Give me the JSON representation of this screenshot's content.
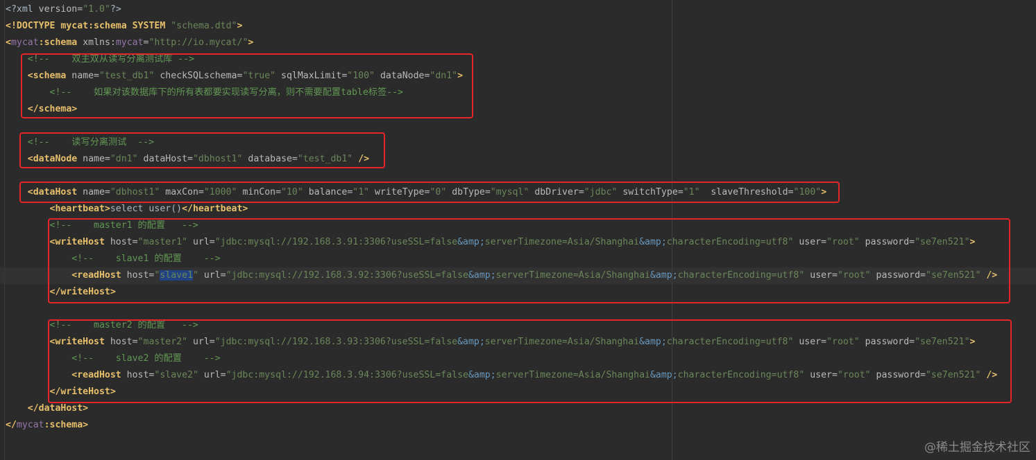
{
  "editor": {
    "lines": [
      [
        {
          "t": "<?",
          "k": "txt"
        },
        {
          "t": "xml",
          "k": "txt"
        },
        {
          "t": " version=",
          "k": "a"
        },
        {
          "t": "\"1.0\"",
          "k": "v"
        },
        {
          "t": "?>",
          "k": "txt"
        }
      ],
      [
        {
          "t": "<!",
          "k": "t"
        },
        {
          "t": "DOCTYPE mycat:schema SYSTEM ",
          "k": "t"
        },
        {
          "t": "\"schema.dtd\"",
          "k": "v"
        },
        {
          "t": ">",
          "k": "t"
        }
      ],
      [
        {
          "t": "<",
          "k": "t"
        },
        {
          "t": "mycat",
          "k": "ns"
        },
        {
          "t": ":schema ",
          "k": "t"
        },
        {
          "t": "xmlns:",
          "k": "a"
        },
        {
          "t": "mycat",
          "k": "ns"
        },
        {
          "t": "=",
          "k": "a"
        },
        {
          "t": "\"http://io.mycat/\"",
          "k": "v"
        },
        {
          "t": ">",
          "k": "t"
        }
      ],
      [
        {
          "t": "    <!--    双主双从读写分离测试库 -->",
          "k": "c"
        }
      ],
      [
        {
          "t": "    <schema ",
          "k": "t"
        },
        {
          "t": "name=",
          "k": "a"
        },
        {
          "t": "\"test_db1\"",
          "k": "v"
        },
        {
          "t": " checkSQLschema=",
          "k": "a"
        },
        {
          "t": "\"true\"",
          "k": "v"
        },
        {
          "t": " sqlMaxLimit=",
          "k": "a"
        },
        {
          "t": "\"100\"",
          "k": "v"
        },
        {
          "t": " dataNode=",
          "k": "a"
        },
        {
          "t": "\"dn1\"",
          "k": "v"
        },
        {
          "t": ">",
          "k": "t"
        }
      ],
      [
        {
          "t": "        <!--    如果对该数据库下的所有表都要实现读写分离，则不需要配置table标签-->",
          "k": "c"
        }
      ],
      [
        {
          "t": "    </schema>",
          "k": "t"
        }
      ],
      [
        {
          "t": "",
          "k": "txt"
        }
      ],
      [
        {
          "t": "    <!--    读写分离测试  -->",
          "k": "c"
        }
      ],
      [
        {
          "t": "    <dataNode ",
          "k": "t"
        },
        {
          "t": "name=",
          "k": "a"
        },
        {
          "t": "\"dn1\"",
          "k": "v"
        },
        {
          "t": " dataHost=",
          "k": "a"
        },
        {
          "t": "\"dbhost1\"",
          "k": "v"
        },
        {
          "t": " database=",
          "k": "a"
        },
        {
          "t": "\"test_db1\"",
          "k": "v"
        },
        {
          "t": " />",
          "k": "t"
        }
      ],
      [
        {
          "t": "",
          "k": "txt"
        }
      ],
      [
        {
          "t": "    <dataHost ",
          "k": "t"
        },
        {
          "t": "name=",
          "k": "a"
        },
        {
          "t": "\"dbhost1\"",
          "k": "v"
        },
        {
          "t": " maxCon=",
          "k": "a"
        },
        {
          "t": "\"1000\"",
          "k": "v"
        },
        {
          "t": " minCon=",
          "k": "a"
        },
        {
          "t": "\"10\"",
          "k": "v"
        },
        {
          "t": " balance=",
          "k": "a"
        },
        {
          "t": "\"1\"",
          "k": "v"
        },
        {
          "t": " writeType=",
          "k": "a"
        },
        {
          "t": "\"0\"",
          "k": "v"
        },
        {
          "t": " dbType=",
          "k": "a"
        },
        {
          "t": "\"mysql\"",
          "k": "v"
        },
        {
          "t": " dbDriver=",
          "k": "a"
        },
        {
          "t": "\"jdbc\"",
          "k": "v"
        },
        {
          "t": " switchType=",
          "k": "a"
        },
        {
          "t": "\"1\"",
          "k": "v"
        },
        {
          "t": "  slaveThreshold=",
          "k": "a"
        },
        {
          "t": "\"100\"",
          "k": "v"
        },
        {
          "t": ">",
          "k": "t"
        }
      ],
      [
        {
          "t": "        <heartbeat>",
          "k": "t"
        },
        {
          "t": "select user()",
          "k": "txt"
        },
        {
          "t": "</heartbeat>",
          "k": "t"
        }
      ],
      [
        {
          "t": "        <!--    master1 的配置   -->",
          "k": "c"
        }
      ],
      [
        {
          "t": "        <writeHost ",
          "k": "t"
        },
        {
          "t": "host=",
          "k": "a"
        },
        {
          "t": "\"master1\"",
          "k": "v"
        },
        {
          "t": " url=",
          "k": "a"
        },
        {
          "t": "\"jdbc:mysql://192.168.3.91:3306?useSSL=false",
          "k": "v"
        },
        {
          "t": "&amp;",
          "k": "e"
        },
        {
          "t": "serverTimezone=Asia/Shanghai",
          "k": "v"
        },
        {
          "t": "&amp;",
          "k": "e"
        },
        {
          "t": "characterEncoding=utf8\"",
          "k": "v"
        },
        {
          "t": " user=",
          "k": "a"
        },
        {
          "t": "\"root\"",
          "k": "v"
        },
        {
          "t": " password=",
          "k": "a"
        },
        {
          "t": "\"se7en521\"",
          "k": "v"
        },
        {
          "t": ">",
          "k": "t"
        }
      ],
      [
        {
          "t": "            <!--    slave1 的配置    -->",
          "k": "c"
        }
      ],
      [
        {
          "t": "            <readHost ",
          "k": "t"
        },
        {
          "t": "host=",
          "k": "a"
        },
        {
          "t": "\"",
          "k": "v"
        },
        {
          "t": "slave1",
          "k": "v"
        },
        {
          "t": "\"",
          "k": "v"
        },
        {
          "t": " url=",
          "k": "a"
        },
        {
          "t": "\"jdbc:mysql://192.168.3.92:3306?useSSL=false",
          "k": "v"
        },
        {
          "t": "&amp;",
          "k": "e"
        },
        {
          "t": "serverTimezone=Asia/Shanghai",
          "k": "v"
        },
        {
          "t": "&amp;",
          "k": "e"
        },
        {
          "t": "characterEncoding=utf8\"",
          "k": "v"
        },
        {
          "t": " user=",
          "k": "a"
        },
        {
          "t": "\"root\"",
          "k": "v"
        },
        {
          "t": " password=",
          "k": "a"
        },
        {
          "t": "\"se7en521\"",
          "k": "v"
        },
        {
          "t": " />",
          "k": "t"
        }
      ],
      [
        {
          "t": "        </writeHost>",
          "k": "t"
        }
      ],
      [
        {
          "t": "",
          "k": "txt"
        }
      ],
      [
        {
          "t": "        <!--    master2 的配置   -->",
          "k": "c"
        }
      ],
      [
        {
          "t": "        <writeHost ",
          "k": "t"
        },
        {
          "t": "host=",
          "k": "a"
        },
        {
          "t": "\"master2\"",
          "k": "v"
        },
        {
          "t": " url=",
          "k": "a"
        },
        {
          "t": "\"jdbc:mysql://192.168.3.93:3306?useSSL=false",
          "k": "v"
        },
        {
          "t": "&amp;",
          "k": "e"
        },
        {
          "t": "serverTimezone=Asia/Shanghai",
          "k": "v"
        },
        {
          "t": "&amp;",
          "k": "e"
        },
        {
          "t": "characterEncoding=utf8\"",
          "k": "v"
        },
        {
          "t": " user=",
          "k": "a"
        },
        {
          "t": "\"root\"",
          "k": "v"
        },
        {
          "t": " password=",
          "k": "a"
        },
        {
          "t": "\"se7en521\"",
          "k": "v"
        },
        {
          "t": ">",
          "k": "t"
        }
      ],
      [
        {
          "t": "            <!--    slave2 的配置    -->",
          "k": "c"
        }
      ],
      [
        {
          "t": "            <readHost ",
          "k": "t"
        },
        {
          "t": "host=",
          "k": "a"
        },
        {
          "t": "\"slave2\"",
          "k": "v"
        },
        {
          "t": " url=",
          "k": "a"
        },
        {
          "t": "\"jdbc:mysql://192.168.3.94:3306?useSSL=false",
          "k": "v"
        },
        {
          "t": "&amp;",
          "k": "e"
        },
        {
          "t": "serverTimezone=Asia/Shanghai",
          "k": "v"
        },
        {
          "t": "&amp;",
          "k": "e"
        },
        {
          "t": "characterEncoding=utf8\"",
          "k": "v"
        },
        {
          "t": " user=",
          "k": "a"
        },
        {
          "t": "\"root\"",
          "k": "v"
        },
        {
          "t": " password=",
          "k": "a"
        },
        {
          "t": "\"se7en521\"",
          "k": "v"
        },
        {
          "t": " />",
          "k": "t"
        }
      ],
      [
        {
          "t": "        </writeHost>",
          "k": "t"
        }
      ],
      [
        {
          "t": "    </dataHost>",
          "k": "t"
        }
      ],
      [
        {
          "t": "</",
          "k": "t"
        },
        {
          "t": "mycat",
          "k": "ns"
        },
        {
          "t": ":schema>",
          "k": "t"
        }
      ]
    ],
    "caret_line": 16,
    "caret_token": 3
  },
  "colors": {
    "background": "#2b2b2b",
    "tag": "#e8bf6a",
    "attribute": "#bababa",
    "value": "#6a8759",
    "comment": "#629755",
    "namespace": "#9876aa",
    "entity": "#6897bb",
    "highlight_box": "#e5252a"
  },
  "watermark": "@稀土掘金技术社区"
}
